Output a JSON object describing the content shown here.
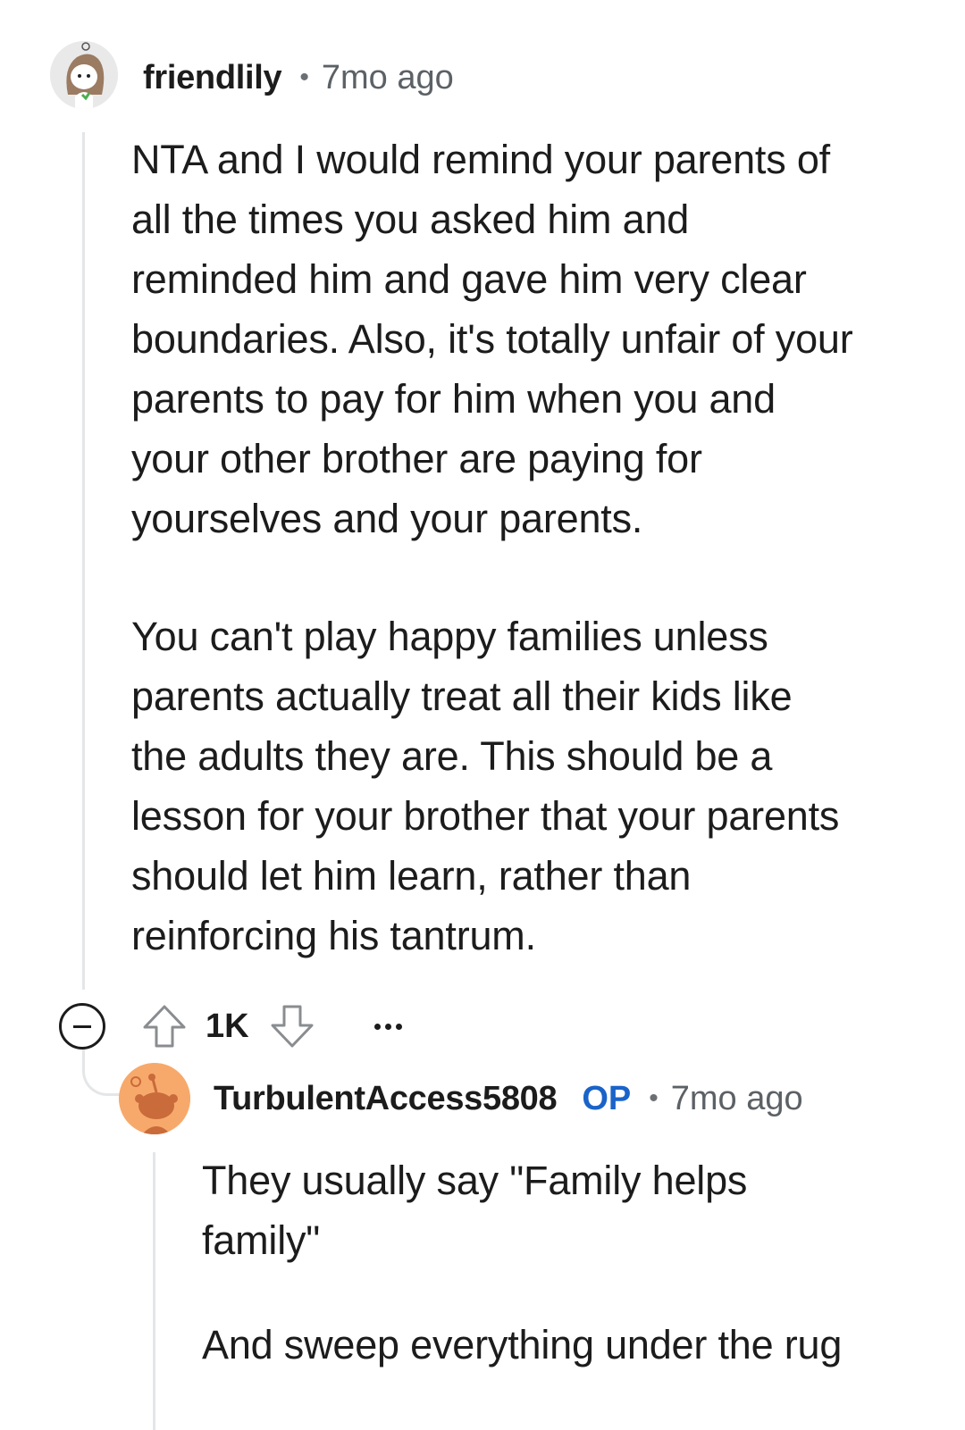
{
  "comment": {
    "username": "friendlily",
    "timestamp": "7mo ago",
    "avatar_icon": "snoo-avatar-icon",
    "paragraphs": [
      "NTA and I would remind your parents of\nall the times you asked him and\nreminded him and gave him very clear\nboundaries. Also, it's totally unfair of your\nparents to pay for him when you and\nyour other brother are paying for\nyourselves and your parents.",
      "You can't play happy families unless\nparents actually treat all their kids like\nthe adults they are. This should be a\nlesson for your brother that your parents\nshould let him learn, rather than\nreinforcing his tantrum."
    ],
    "vote_count": "1K",
    "icons": {
      "collapse": "collapse-minus-icon",
      "upvote": "upvote-arrow-icon",
      "downvote": "downvote-arrow-icon",
      "more": "more-options-icon"
    }
  },
  "reply": {
    "username": "TurbulentAccess5808",
    "badge": "OP",
    "timestamp": "7mo ago",
    "avatar_icon": "snoo-default-avatar-icon",
    "paragraphs": [
      "They usually say \"Family helps\nfamily\"",
      "And sweep everything under the rug"
    ]
  },
  "colors": {
    "op_badge": "#1a63c9",
    "thread_line": "#e4e6e8",
    "reply_avatar_bg": "#f7a96b",
    "text": "#1c1c1c",
    "meta_text": "#5c6166"
  }
}
